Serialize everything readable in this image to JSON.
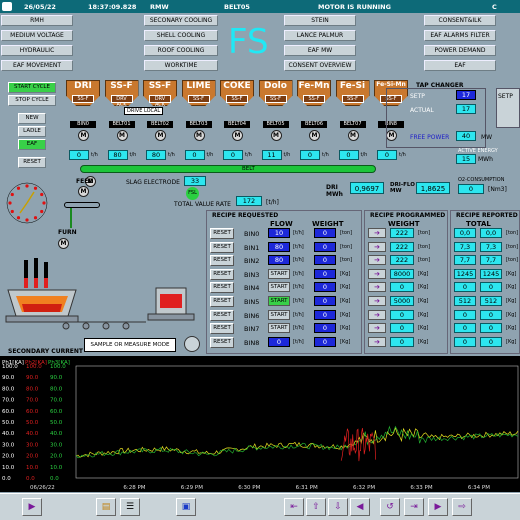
{
  "header": {
    "date": "26/05/22",
    "time": "18:37:09.828",
    "user": "RMW",
    "belt": "BELT05",
    "status": "MOTOR IS RUNNING",
    "right_code": "C"
  },
  "menu_left": [
    "RMH",
    "MEDIUM VOLTAGE",
    "HYDRAULIC",
    "EAF MOVEMENT"
  ],
  "menu_mid": [
    "SECONARY COOLING",
    "SHELL COOLING",
    "ROOF COOLING",
    "WORKTIME"
  ],
  "menu_right": [
    "STEIN",
    "LANCE PALMUR",
    "EAF MW",
    "CONSENT OVERVIEW"
  ],
  "menu_far": [
    "CONSENT&ILK",
    "EAF ALARMS FILTER",
    "POWER DEMAND",
    "EAF"
  ],
  "fs_label": "FS",
  "left_buttons": [
    "START CYCLE",
    "STOP CYCLE",
    "NEW",
    "LADLE",
    "EAF",
    "RESET"
  ],
  "hoppers": [
    {
      "name": "DRI",
      "bin": "BIN0",
      "ssf": "SS-F",
      "flow": "0",
      "unit": "t/h"
    },
    {
      "name": "SS-F",
      "bin": "BELT01",
      "ssf": "DRV ACK",
      "flow": "80",
      "unit": "t/h",
      "sub": "DRI"
    },
    {
      "name": "SS-F",
      "bin": "BELT02",
      "ssf": "DRV ACK",
      "flow": "80",
      "unit": "t/h",
      "sub": "DRI2"
    },
    {
      "name": "LIME",
      "bin": "BELT03",
      "ssf": "SS-F",
      "flow": "0",
      "unit": "t/h"
    },
    {
      "name": "COKE",
      "bin": "BELT04",
      "ssf": "SS-F",
      "flow": "0",
      "unit": "t/h"
    },
    {
      "name": "Dolo",
      "bin": "BELT05",
      "ssf": "SS-F",
      "flow": "11",
      "unit": "t/h"
    },
    {
      "name": "Fe-Mn",
      "bin": "BELT06",
      "ssf": "SS-F",
      "flow": "0",
      "unit": "t/h"
    },
    {
      "name": "Fe-Si",
      "bin": "BELT07",
      "ssf": "SS-F",
      "flow": "0",
      "unit": "t/h"
    },
    {
      "name": "Fe-Si-Mn",
      "bin": "BIN8",
      "ssf": "SS-F",
      "flow": "0",
      "unit": "t/h"
    }
  ],
  "drive_local": "DRIVE LOCAL",
  "belt_label": "BELT",
  "slag": {
    "label": "SLAG ELECTRODE",
    "value": "33",
    "fsl": "FSL"
  },
  "total_rate": {
    "label": "TOTAL VALUE RATE",
    "value": "172",
    "unit": "[t/h]"
  },
  "tap": {
    "title": "TAP CHANGER",
    "setp_label": "SETP",
    "setp": "17",
    "actual_label": "ACTUAL",
    "actual": "17",
    "fp_label": "FREE POWER",
    "fp": "40",
    "fp_unit": "MW",
    "setp2": "SETP"
  },
  "energy": {
    "label": "ACTIVE ENERGY",
    "value": "15",
    "unit": "MWh"
  },
  "dri": {
    "label": "DRI MWh",
    "value": "0,9697",
    "flo_label": "DRI-FLO MW",
    "flo": "1,8625",
    "o2_label": "O2-CONSUMPTION",
    "o2": "0",
    "o2_unit": "[Nm3]"
  },
  "feed": {
    "label": "FEED",
    "m": "M",
    "furn": "FURN"
  },
  "recipe": {
    "req_title": "RECIPE REQUESTED",
    "flow_h": "FLOW",
    "weight_h": "WEIGHT",
    "prog_title": "RECIPE PROGRAMMED",
    "prog_weight_h": "WEIGHT",
    "rep_title": "RECIPE REPORTED",
    "rep_total_h": "TOTAL",
    "rows": [
      {
        "reset": "RESET",
        "bin": "BIN0",
        "flow": "10",
        "funit": "[t/h]",
        "weight": "0",
        "wunit": "[ton]",
        "prog": "222",
        "punit": "[ton]",
        "r1": "0,0",
        "r2": "0,0",
        "start": ""
      },
      {
        "reset": "RESET",
        "bin": "BIN1",
        "flow": "80",
        "funit": "[t/h]",
        "weight": "0",
        "wunit": "[ton]",
        "prog": "222",
        "punit": "[ton]",
        "r1": "7,3",
        "r2": "7,3",
        "start": ""
      },
      {
        "reset": "RESET",
        "bin": "BIN2",
        "flow": "80",
        "funit": "[t/h]",
        "weight": "0",
        "wunit": "[ton]",
        "prog": "222",
        "punit": "[ton]",
        "r1": "7,7",
        "r2": "7,7",
        "start": ""
      },
      {
        "reset": "RESET",
        "bin": "BIN3",
        "flow": "",
        "funit": "[t/h]",
        "weight": "0",
        "wunit": "[Kg]",
        "prog": "8000",
        "punit": "[Kg]",
        "r1": "1245",
        "r2": "1245",
        "start": "START"
      },
      {
        "reset": "RESET",
        "bin": "BIN4",
        "flow": "",
        "funit": "[t/h]",
        "weight": "0",
        "wunit": "[Kg]",
        "prog": "0",
        "punit": "[Kg]",
        "r1": "0",
        "r2": "0",
        "start": "START"
      },
      {
        "reset": "RESET",
        "bin": "BIN5",
        "flow": "",
        "funit": "[t/h]",
        "weight": "0",
        "wunit": "[Kg]",
        "prog": "5000",
        "punit": "[Kg]",
        "r1": "512",
        "r2": "512",
        "start": "START"
      },
      {
        "reset": "RESET",
        "bin": "BIN6",
        "flow": "",
        "funit": "[t/h]",
        "weight": "0",
        "wunit": "[Kg]",
        "prog": "0",
        "punit": "[Kg]",
        "r1": "0",
        "r2": "0",
        "start": "START"
      },
      {
        "reset": "RESET",
        "bin": "BIN7",
        "flow": "",
        "funit": "[t/h]",
        "weight": "0",
        "wunit": "[Kg]",
        "prog": "0",
        "punit": "[Kg]",
        "r1": "0",
        "r2": "0",
        "start": "START"
      },
      {
        "reset": "RESET",
        "bin": "BIN8",
        "flow": "0",
        "funit": "[t/h]",
        "weight": "0",
        "wunit": "[Kg]",
        "prog": "0",
        "punit": "[Kg]",
        "r1": "0",
        "r2": "0",
        "start": ""
      }
    ]
  },
  "sample_mode": "SAMPLE OR MEASURE MODE",
  "secondary_current": "SECONDARY CURRENT",
  "chart_data": {
    "type": "line",
    "y_headers": [
      "Ph1[KA]",
      "Ph2[KA]",
      "Ph3[KA]"
    ],
    "y_ticks": [
      "100.0",
      "90.0",
      "80.0",
      "70.0",
      "60.0",
      "50.0",
      "40.0",
      "30.0",
      "20.0",
      "10.0",
      "0.0"
    ],
    "ylim": [
      0,
      100
    ],
    "x_ticks": [
      "06/26/22",
      "6:28 PM",
      "6:29 PM",
      "6:30 PM",
      "6:31 PM",
      "6:32 PM",
      "6:33 PM",
      "6:34 PM"
    ],
    "series": [
      {
        "color": "#e8e020",
        "approx_level": [
          20,
          24,
          26,
          22,
          28,
          30,
          28,
          40,
          36,
          38,
          40
        ]
      },
      {
        "color": "#22b030",
        "approx_level": [
          20,
          23,
          25,
          21,
          27,
          29,
          27,
          42,
          35,
          37,
          39
        ]
      },
      {
        "color": "#e02020",
        "approx_level": [
          0,
          0,
          0,
          0,
          0,
          0,
          0,
          45,
          0,
          0,
          0
        ]
      }
    ]
  },
  "bottom_icons": [
    "play-icon",
    "folder-icon",
    "list-icon",
    "trend-icon",
    "nav-first-icon",
    "up-icon",
    "down-icon",
    "nav-left-icon",
    "nav-right-icon",
    "refresh-icon",
    "export-icon",
    "forward-icon"
  ]
}
